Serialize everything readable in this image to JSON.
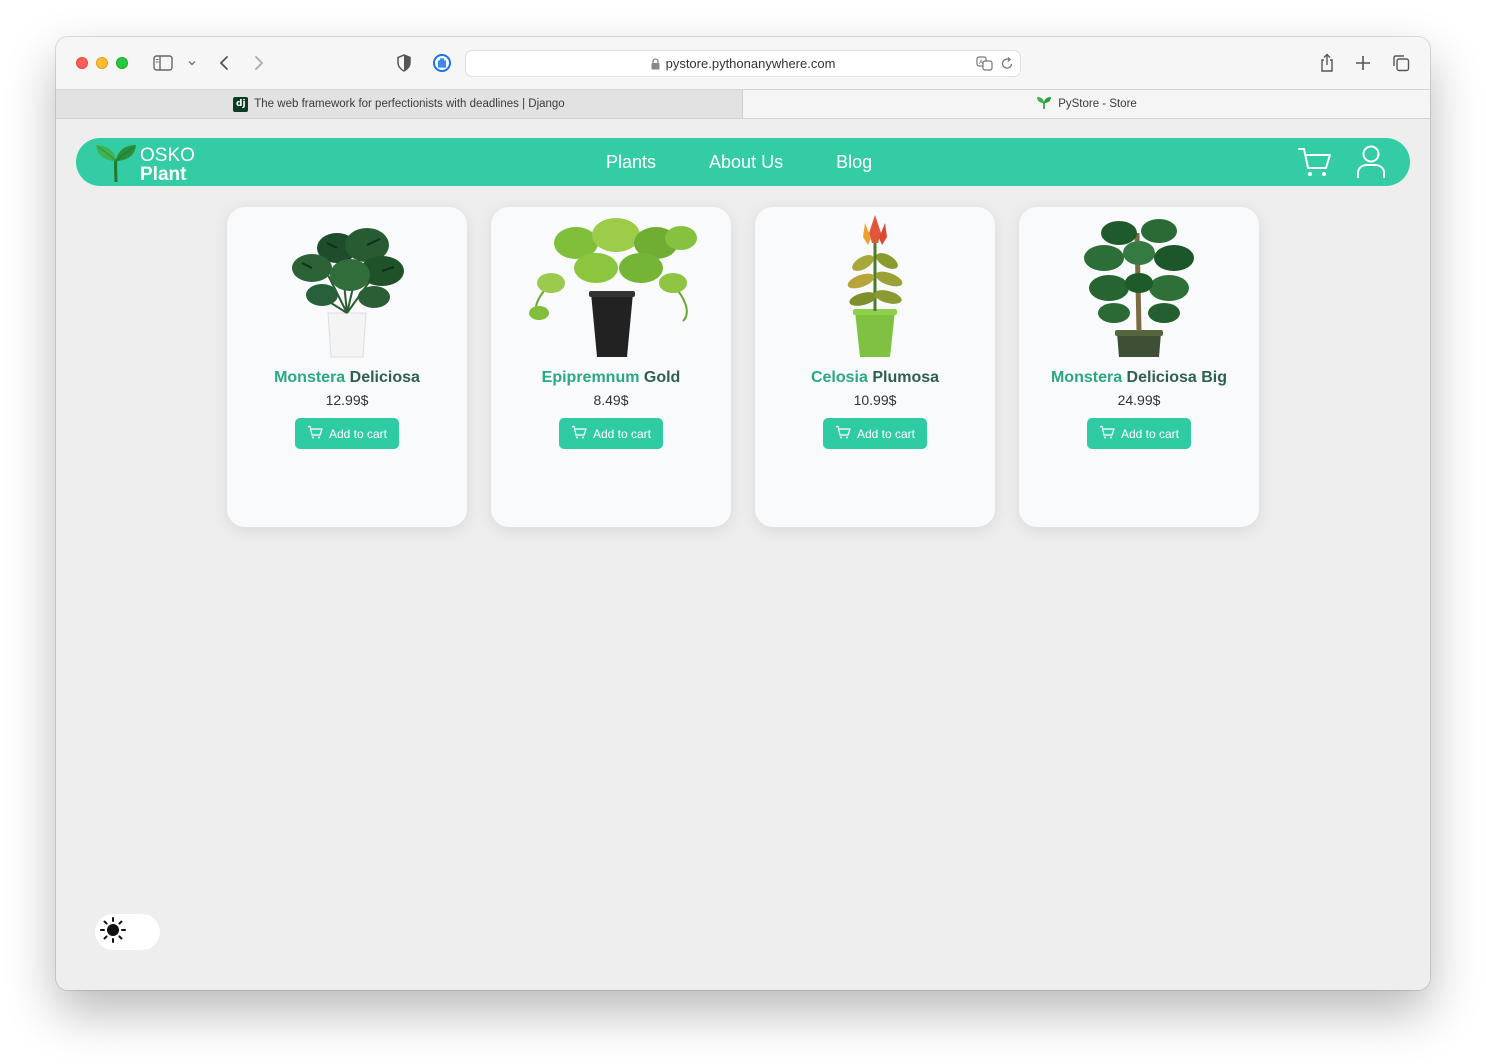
{
  "browser": {
    "url": "pystore.pythonanywhere.com",
    "tabs": [
      {
        "title": "The web framework for perfectionists with deadlines | Django",
        "favicon": "django-icon",
        "active": false
      },
      {
        "title": "PyStore - Store",
        "favicon": "sprout-icon",
        "active": true
      }
    ]
  },
  "site": {
    "brand_line1": "OSKO",
    "brand_line2": "Plant",
    "nav": [
      "Plants",
      "About Us",
      "Blog"
    ],
    "accent": "#33cca5"
  },
  "products": [
    {
      "name_part1": "Monstera ",
      "name_part2": "Deliciosa",
      "price": "12.99$",
      "button": "Add to cart",
      "image": "monstera-plant-image"
    },
    {
      "name_part1": "Epipremnum ",
      "name_part2": "Gold",
      "price": "8.49$",
      "button": "Add to cart",
      "image": "pothos-plant-image"
    },
    {
      "name_part1": "Celosia ",
      "name_part2": "Plumosa",
      "price": "10.99$",
      "button": "Add to cart",
      "image": "celosia-plant-image"
    },
    {
      "name_part1": "Monstera ",
      "name_part2": "Deliciosa Big",
      "price": "24.99$",
      "button": "Add to cart",
      "image": "monstera-big-plant-image"
    }
  ],
  "theme_toggle": {
    "icon": "sun-icon",
    "mode": "light"
  }
}
